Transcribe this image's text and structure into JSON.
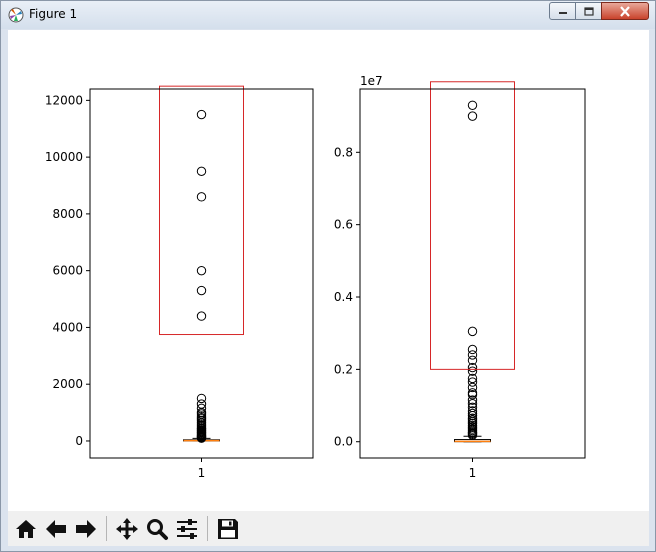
{
  "window": {
    "title": "Figure 1"
  },
  "toolbar": {
    "buttons": [
      {
        "name": "home",
        "icon": "home-icon"
      },
      {
        "name": "back",
        "icon": "arrow-left-icon"
      },
      {
        "name": "forward",
        "icon": "arrow-right-icon"
      },
      {
        "name": "pan",
        "icon": "move-icon"
      },
      {
        "name": "zoom",
        "icon": "magnifier-icon"
      },
      {
        "name": "configure-subplots",
        "icon": "sliders-icon"
      },
      {
        "name": "save",
        "icon": "floppy-disk-icon"
      }
    ]
  },
  "colors": {
    "highlight_box": "#d62728",
    "median": "#ff7f0e",
    "box": "#000000"
  },
  "chart_data": [
    {
      "type": "boxplot",
      "categories": [
        "1"
      ],
      "ylim": [
        -600,
        12400
      ],
      "yticks": [
        0,
        2000,
        4000,
        6000,
        8000,
        10000,
        12000
      ],
      "xtick_labels": [
        "1"
      ],
      "offset_label": "",
      "median": 10,
      "q1": 2,
      "q3": 40,
      "whisker_low": 0,
      "whisker_high": 90,
      "outliers": [
        11500,
        9500,
        8600,
        6000,
        5300,
        4400,
        1500,
        1300,
        1150,
        1000,
        950,
        880,
        820,
        780,
        720,
        650,
        600,
        550,
        500,
        450,
        420,
        380,
        350,
        320,
        290,
        260,
        230,
        200,
        180,
        160,
        140,
        120,
        100
      ],
      "highlight_box": {
        "y_low": 3750,
        "y_high": 12500
      },
      "grid": false
    },
    {
      "type": "boxplot",
      "categories": [
        "1"
      ],
      "ylim": [
        -450000,
        9750000
      ],
      "yticks": [
        0,
        2000000,
        4000000,
        6000000,
        8000000
      ],
      "ytick_labels": [
        "0.0",
        "0.2",
        "0.4",
        "0.6",
        "0.8"
      ],
      "xtick_labels": [
        "1"
      ],
      "offset_label": "1e7",
      "median": 10000,
      "q1": 2000,
      "q3": 60000,
      "whisker_low": 0,
      "whisker_high": 150000,
      "outliers": [
        9300000,
        9000000,
        3050000,
        2550000,
        2400000,
        2250000,
        2050000,
        1950000,
        1750000,
        1650000,
        1500000,
        1350000,
        1300000,
        1150000,
        1050000,
        950000,
        850000,
        780000,
        720000,
        650000,
        600000,
        550000,
        500000,
        450000,
        400000,
        350000,
        310000,
        270000,
        240000,
        210000,
        180000
      ],
      "highlight_box": {
        "y_low": 2000000,
        "y_high": 9950000
      },
      "grid": false
    }
  ]
}
